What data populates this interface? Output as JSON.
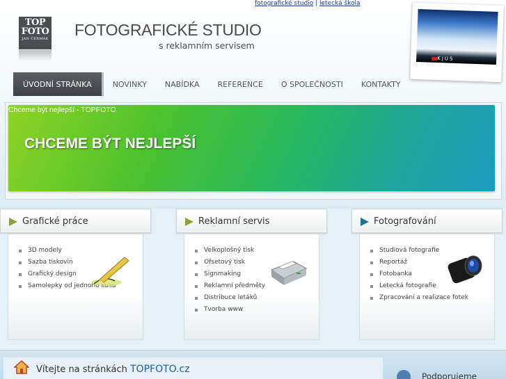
{
  "top_links": {
    "link1": "fotografické studio",
    "separator": "|",
    "link2": "letecká škola"
  },
  "logo": {
    "line1": "TOP",
    "line2": "FOTO",
    "line3": "JAN ČERMÁK"
  },
  "header": {
    "title": "FOTOGRAFICKÉ STUDIO",
    "subtitle": "s reklamním servisem"
  },
  "photo": {
    "caption": "KJUS"
  },
  "menu": [
    {
      "label": "ÚVODNÍ STRÁNKA",
      "active": true
    },
    {
      "label": "NOVINKY"
    },
    {
      "label": "NABÍDKA"
    },
    {
      "label": "REFERENCE"
    },
    {
      "label": "O SPOLEČNOSTI"
    },
    {
      "label": "KONTAKTY"
    }
  ],
  "banner": {
    "small_text": "Chceme být nejlepší - TOPFOTO",
    "big_text": "CHCEME BÝT NEJLEPŠÍ"
  },
  "boxes": [
    {
      "title": "Grafické práce",
      "items": [
        "3D modely",
        "Sazba tiskovin",
        "Grafický design",
        "Samolepky od jednoho kusu"
      ],
      "icon": "pencil-icon"
    },
    {
      "title": "Reklamní servis",
      "items": [
        "Velkoplošný tisk",
        "Ofsetový tisk",
        "Signmaking",
        "Reklamní předměty",
        "Distribuce letáků",
        "Tvorba www"
      ],
      "icon": "printer-icon"
    },
    {
      "title": "Fotografování",
      "items": [
        "Studiová fotografie",
        "Reportáž",
        "Fotobanka",
        "Letecká fotografie",
        "Zpracování a realizace fotek"
      ],
      "icon": "camera-lens-icon"
    }
  ],
  "welcome": {
    "prefix": "Vítejte na stránkách",
    "site": "TOPFOTO.cz"
  },
  "support": {
    "label": "Podporujeme"
  },
  "colors": {
    "accent_green": "#8aa038",
    "link_blue": "#1b3f8f",
    "menu_active": "#4a4d52"
  }
}
